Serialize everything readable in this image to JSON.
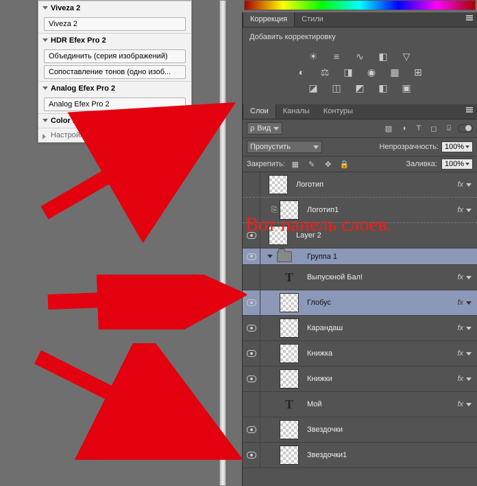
{
  "left": {
    "sections": [
      {
        "title": "Viveza 2",
        "items": [
          "Viveza 2"
        ]
      },
      {
        "title": "HDR Efex Pro 2",
        "items": [
          "Объединить (серия изображений)",
          "Сопоставление тонов (одно изоб..."
        ]
      },
      {
        "title": "Analog Efex Pro 2",
        "items": [
          "Analog Efex Pro 2"
        ]
      },
      {
        "title": "Color Efex Pro 4",
        "items": []
      }
    ],
    "footer": "Настройки"
  },
  "adjustments": {
    "tabs": [
      "Коррекция",
      "Стили"
    ],
    "active": 0,
    "title": "Добавить корректировку",
    "rows": [
      [
        "brightness",
        "levels",
        "curves",
        "exposure",
        "vibrance"
      ],
      [
        "hue",
        "balance",
        "bw",
        "photo",
        "mixer",
        "lookup"
      ],
      [
        "invert",
        "poster",
        "threshold",
        "gradient",
        "selective"
      ]
    ]
  },
  "layersPanel": {
    "tabs": [
      "Слои",
      "Каналы",
      "Контуры"
    ],
    "active": 0,
    "kindLabel": "Вид",
    "filterIcons": [
      "image",
      "fx",
      "text",
      "shape",
      "smart"
    ],
    "blend": "Пропустить",
    "opacityLabel": "Непрозрачность:",
    "opacity": "100%",
    "lockLabel": "Закрепить:",
    "fillLabel": "Заливка:",
    "fill": "100%",
    "layers": [
      {
        "vis": false,
        "type": "raster",
        "name": "Логотип",
        "fx": true,
        "dashed": true
      },
      {
        "vis": false,
        "type": "raster",
        "name": "Логотип1",
        "fx": true,
        "link": true,
        "indent": true,
        "dashed": true
      },
      {
        "vis": true,
        "type": "raster",
        "name": "Layer 2",
        "fx": false
      },
      {
        "vis": true,
        "type": "group",
        "name": "Группа 1",
        "selected": true
      },
      {
        "vis": false,
        "type": "text",
        "name": "Выпускной Бал!",
        "fx": true,
        "indent": true
      },
      {
        "vis": true,
        "type": "raster",
        "name": "Глобус",
        "fx": true,
        "indent": true,
        "selected": true
      },
      {
        "vis": true,
        "type": "raster",
        "name": "Карандаш",
        "fx": true,
        "indent": true
      },
      {
        "vis": true,
        "type": "raster",
        "name": "Книжка",
        "fx": true,
        "indent": true
      },
      {
        "vis": true,
        "type": "raster",
        "name": "Книжки",
        "fx": true,
        "indent": true
      },
      {
        "vis": false,
        "type": "text",
        "name": "Мой",
        "fx": true,
        "indent": true
      },
      {
        "vis": true,
        "type": "raster",
        "name": "Звездочки",
        "fx": false,
        "indent": true
      },
      {
        "vis": true,
        "type": "raster",
        "name": "Звездочки1",
        "fx": false,
        "indent": true
      }
    ]
  },
  "annotation": "Вот панель слоев."
}
